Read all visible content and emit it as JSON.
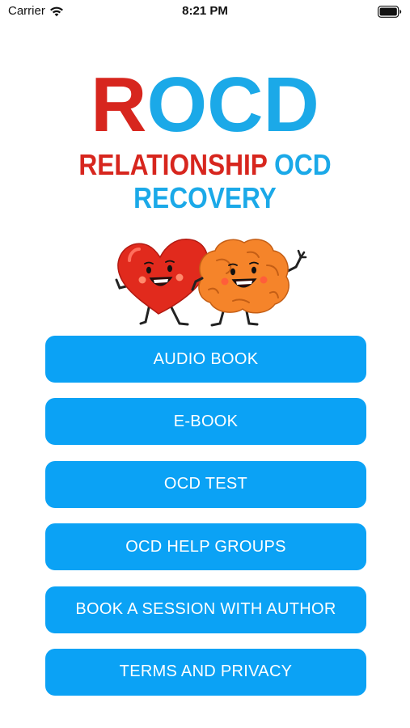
{
  "status_bar": {
    "carrier": "Carrier",
    "time": "8:21 PM",
    "icons": [
      "wifi-icon",
      "battery-icon"
    ]
  },
  "logo": {
    "letter_r": "R",
    "letters_ocd": "OCD",
    "line2_relationship": "RELATIONSHIP",
    "line2_ocd": "OCD",
    "line3": "RECOVERY",
    "colors": {
      "red": "#d7261e",
      "blue": "#1ba9e8"
    }
  },
  "mascot": {
    "icons": [
      "heart-character-icon",
      "brain-character-icon"
    ]
  },
  "menu": {
    "button_color": "#0ba2f5",
    "items": [
      {
        "label": "AUDIO BOOK"
      },
      {
        "label": "E-BOOK"
      },
      {
        "label": "OCD TEST"
      },
      {
        "label": "OCD HELP GROUPS"
      },
      {
        "label": "BOOK A SESSION WITH AUTHOR"
      },
      {
        "label": "TERMS AND PRIVACY"
      }
    ]
  }
}
